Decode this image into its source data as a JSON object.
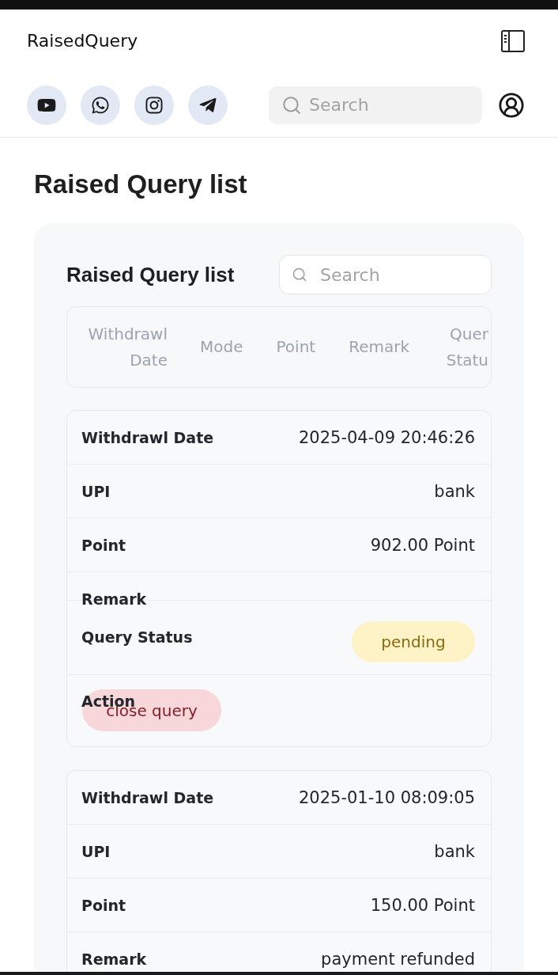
{
  "app": {
    "title": "RaisedQuery"
  },
  "toolbar": {
    "search": {
      "placeholder": "Search"
    }
  },
  "page": {
    "title": "Raised Query list"
  },
  "panel": {
    "title": "Raised Query list",
    "search": {
      "placeholder": "Search"
    },
    "table": {
      "columns": [
        "Withdrawl Date",
        "Mode",
        "Point",
        "Remark",
        "Quer Statu"
      ]
    },
    "records": [
      {
        "fields": [
          {
            "kind": "text",
            "label": "Withdrawl Date",
            "value": "2025-04-09 20:46:26"
          },
          {
            "kind": "text",
            "label": "UPI",
            "value": "bank"
          },
          {
            "kind": "text",
            "label": "Point",
            "value": "902.00 Point"
          },
          {
            "kind": "text",
            "label": "Remark"
          },
          {
            "kind": "status",
            "label": "Query Status",
            "value": "pending"
          },
          {
            "kind": "action",
            "label": "Action",
            "value": "close query"
          }
        ]
      },
      {
        "fields": [
          {
            "kind": "text",
            "label": "Withdrawl Date",
            "value": "2025-01-10 08:09:05"
          },
          {
            "kind": "text",
            "label": "UPI",
            "value": "bank"
          },
          {
            "kind": "text",
            "label": "Point",
            "value": "150.00 Point"
          },
          {
            "kind": "text",
            "label": "Remark",
            "value": "payment refunded"
          }
        ]
      }
    ]
  }
}
